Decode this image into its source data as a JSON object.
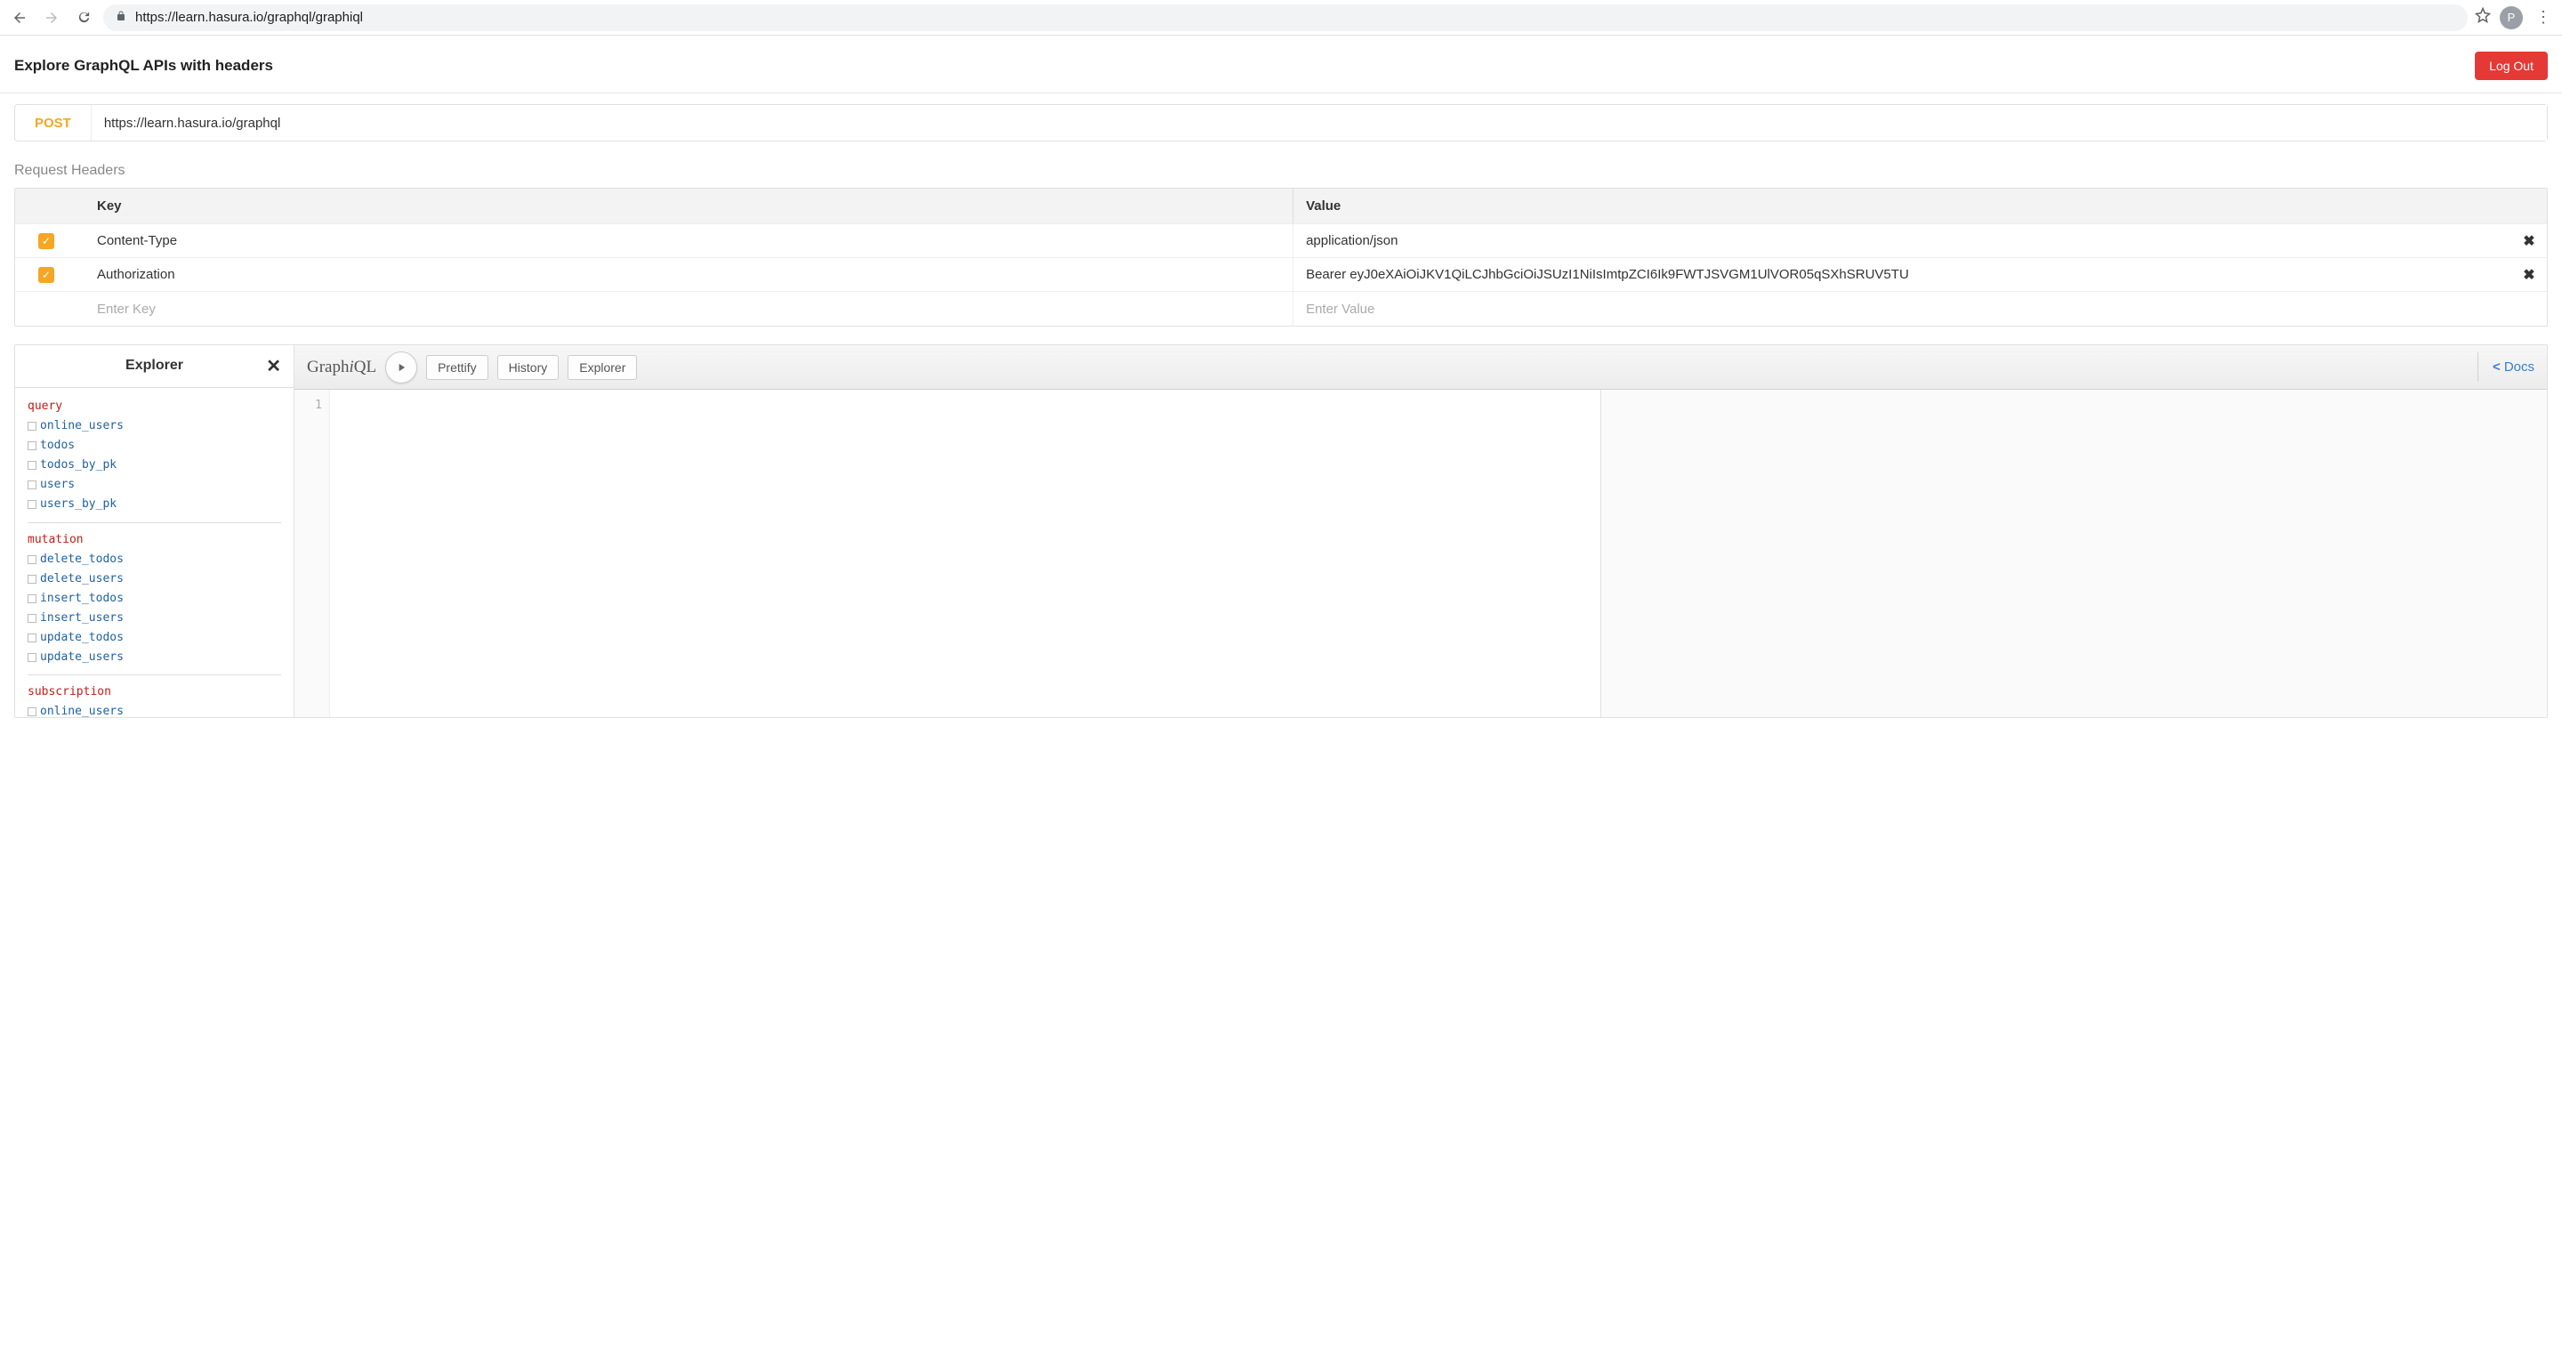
{
  "browser": {
    "url": "https://learn.hasura.io/graphql/graphiql",
    "avatar_initial": "P"
  },
  "header": {
    "title": "Explore GraphQL APIs with headers",
    "logout": "Log Out"
  },
  "endpoint": {
    "method": "POST",
    "url": "https://learn.hasura.io/graphql"
  },
  "headers_section": {
    "label": "Request Headers",
    "columns": {
      "key": "Key",
      "value": "Value"
    },
    "rows": [
      {
        "enabled": true,
        "key": "Content-Type",
        "value": "application/json"
      },
      {
        "enabled": true,
        "key": "Authorization",
        "value": "Bearer eyJ0eXAiOiJKV1QiLCJhbGciOiJSUzI1NiIsImtpZCI6Ik9FWTJSVGM1UlVOR05qSXhSRUV5TU"
      }
    ],
    "placeholder_key": "Enter Key",
    "placeholder_value": "Enter Value"
  },
  "explorer": {
    "title": "Explorer",
    "groups": [
      {
        "label": "query",
        "items": [
          "online_users",
          "todos",
          "todos_by_pk",
          "users",
          "users_by_pk"
        ]
      },
      {
        "label": "mutation",
        "items": [
          "delete_todos",
          "delete_users",
          "insert_todos",
          "insert_users",
          "update_todos",
          "update_users"
        ]
      },
      {
        "label": "subscription",
        "items": [
          "online_users"
        ]
      }
    ]
  },
  "graphiql": {
    "logo_plain_1": "Graph",
    "logo_italic": "i",
    "logo_plain_2": "QL",
    "prettify": "Prettify",
    "history": "History",
    "explorer": "Explorer",
    "docs": "Docs",
    "line_no": "1"
  }
}
